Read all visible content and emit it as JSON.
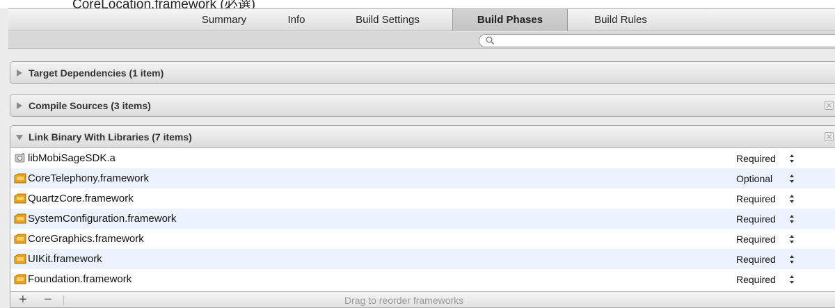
{
  "caption": {
    "text": "CoreLocation.framework (必選)"
  },
  "tabs": [
    {
      "label": "Summary",
      "active": false
    },
    {
      "label": "Info",
      "active": false
    },
    {
      "label": "Build Settings",
      "active": false
    },
    {
      "label": "Build Phases",
      "active": true
    },
    {
      "label": "Build Rules",
      "active": false
    }
  ],
  "search": {
    "icon": "magnifier-icon",
    "value": "",
    "placeholder": ""
  },
  "phases": {
    "target_dependencies": {
      "title": "Target Dependencies (1 item)",
      "expanded": false
    },
    "compile_sources": {
      "title": "Compile Sources (3 items)",
      "expanded": false
    },
    "link_binary": {
      "title": "Link Binary With Libraries (7 items)",
      "expanded": true
    }
  },
  "libraries": [
    {
      "name": "libMobiSageSDK.a",
      "status": "Required",
      "icon": "static-library-icon"
    },
    {
      "name": "CoreTelephony.framework",
      "status": "Optional",
      "icon": "framework-icon"
    },
    {
      "name": "QuartzCore.framework",
      "status": "Required",
      "icon": "framework-icon"
    },
    {
      "name": "SystemConfiguration.framework",
      "status": "Required",
      "icon": "framework-icon"
    },
    {
      "name": "CoreGraphics.framework",
      "status": "Required",
      "icon": "framework-icon"
    },
    {
      "name": "UIKit.framework",
      "status": "Required",
      "icon": "framework-icon"
    },
    {
      "name": "Foundation.framework",
      "status": "Required",
      "icon": "framework-icon"
    }
  ],
  "footer": {
    "add_label": "+",
    "remove_label": "−",
    "hint": "Drag to reorder frameworks"
  },
  "colors": {
    "row_alt": "#edf3fe",
    "framework_icon": "#e8a31a"
  }
}
